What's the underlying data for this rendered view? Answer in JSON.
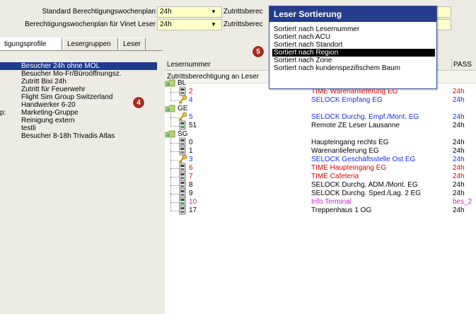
{
  "form": {
    "row1_label": "Standard Berechtigungswochenplan",
    "row1_value": "24h",
    "row1_label2": "Zutrittsberec",
    "row2_label": "Berechtigungswochenplan für Vinet Leser",
    "row2_value": "24h",
    "row2_label2": "Zutrittsberec",
    "dropdown_glyph": "▼"
  },
  "tabs": [
    {
      "label": "tigungsprofile",
      "active": true
    },
    {
      "label": "Lesergruppen",
      "active": false
    },
    {
      "label": "Leser",
      "active": false
    }
  ],
  "profiles": [
    {
      "label": "Besucher 24h ohne MOL",
      "selected": true,
      "prefix": ""
    },
    {
      "label": "Besucher Mo-Fr/Büroöffnungsz.",
      "selected": false,
      "prefix": ""
    },
    {
      "label": "Zutritt Bixi 24h",
      "selected": false,
      "prefix": ""
    },
    {
      "label": "Zutritt für Feuerwehr",
      "selected": false,
      "prefix": ""
    },
    {
      "label": "Flight Sim Group Switzerland",
      "selected": false,
      "prefix": ""
    },
    {
      "label": "Handwerker 6-20",
      "selected": false,
      "prefix": ""
    },
    {
      "label": "Marketing-Gruppe",
      "selected": false,
      "prefix": "p:"
    },
    {
      "label": "Reinigung extern",
      "selected": false,
      "prefix": ""
    },
    {
      "label": "testli",
      "selected": false,
      "prefix": ""
    },
    {
      "label": "Besucher 8-18h Trivadis Atlas",
      "selected": false,
      "prefix": ""
    }
  ],
  "grid": {
    "col_reader": "Lesernummer",
    "col_pass": "PASS",
    "subheader": "Zutrittsberechtigung an Leser",
    "groups": [
      {
        "name": "BL",
        "readers": [
          {
            "num": "2",
            "icon": "terminal",
            "name": "TIME Warenanlieferung EG",
            "pass": "24h",
            "color": "#e00000"
          },
          {
            "num": "4",
            "icon": "key",
            "name": "SELOCK Empfang EG",
            "pass": "24h",
            "color": "#1a2ee8"
          }
        ]
      },
      {
        "name": "GE",
        "readers": [
          {
            "num": "5",
            "icon": "key",
            "name": "SELOCK Durchg. Empf./Mont. EG",
            "pass": "24h",
            "color": "#1a2ee8"
          },
          {
            "num": "51",
            "icon": "terminal-green",
            "name": "Remote ZE Leser Lausanne",
            "pass": "24h",
            "color": "#000000"
          }
        ]
      },
      {
        "name": "SG",
        "readers": [
          {
            "num": "0",
            "icon": "terminal",
            "name": "Haupteingang rechts EG",
            "pass": "24h",
            "color": "#000000"
          },
          {
            "num": "1",
            "icon": "terminal",
            "name": "Warenanlieferung EG",
            "pass": "24h",
            "color": "#000000"
          },
          {
            "num": "3",
            "icon": "key",
            "name": "SELOCK Geschäftsstelle Ost EG",
            "pass": "24h",
            "color": "#1a2ee8"
          },
          {
            "num": "6",
            "icon": "terminal",
            "name": "TIME Haupteingang EG",
            "pass": "24h",
            "color": "#e00000"
          },
          {
            "num": "7",
            "icon": "terminal",
            "name": "TIME Cafeteria",
            "pass": "24h",
            "color": "#e00000"
          },
          {
            "num": "8",
            "icon": "terminal",
            "name": "SELOCK Durchg. ADM./Mont. EG",
            "pass": "24h",
            "color": "#000000"
          },
          {
            "num": "9",
            "icon": "terminal",
            "name": "SELOCK Durchg. Sped./Lag. 2 EG",
            "pass": "24h",
            "color": "#000000"
          },
          {
            "num": "10",
            "icon": "terminal-green",
            "name": "Info Terminal",
            "pass": "bes_2",
            "color": "#d020d0"
          },
          {
            "num": "17",
            "icon": "terminal",
            "name": "Treppenhaus 1 OG",
            "pass": "24h",
            "color": "#000000"
          }
        ]
      }
    ]
  },
  "popup": {
    "title": "Leser Sortierung",
    "items": [
      {
        "label": "Sortiert nach Lesernummer",
        "highlighted": false
      },
      {
        "label": "Sortiert nach ACU",
        "highlighted": false
      },
      {
        "label": "Sortiert nach Standort",
        "highlighted": false
      },
      {
        "label": "Sortiert nach Region",
        "highlighted": true
      },
      {
        "label": "Sortiert nach Zone",
        "highlighted": false
      },
      {
        "label": "Sortiert nach kundenspezifischem Baum",
        "highlighted": false
      }
    ]
  },
  "callouts": {
    "left": "4",
    "popup": "5"
  },
  "colors": {
    "selection": "#1f3b8e",
    "popup_title": "#263c8c",
    "callout": "#a8301e",
    "input_bg": "#ffffc8"
  }
}
